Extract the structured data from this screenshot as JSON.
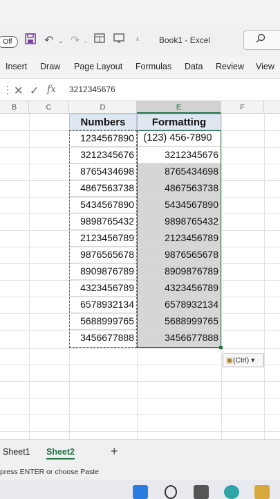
{
  "titlebar": {
    "autosave": "Off",
    "title": "Book1 - Excel"
  },
  "ribbon": {
    "tabs": [
      "Insert",
      "Draw",
      "Page Layout",
      "Formulas",
      "Data",
      "Review",
      "View"
    ]
  },
  "formula_bar": {
    "fx": "fx",
    "value": "3212345676"
  },
  "columns": [
    "B",
    "C",
    "D",
    "E",
    "F"
  ],
  "table": {
    "headers": [
      "Numbers",
      "Formatting"
    ],
    "rows": [
      [
        "1234567890",
        "(123) 456-7890"
      ],
      [
        "3212345676",
        "3212345676"
      ],
      [
        "8765434698",
        "8765434698"
      ],
      [
        "4867563738",
        "4867563738"
      ],
      [
        "5434567890",
        "5434567890"
      ],
      [
        "9898765432",
        "9898765432"
      ],
      [
        "2123456789",
        "2123456789"
      ],
      [
        "9876565678",
        "9876565678"
      ],
      [
        "8909876789",
        "8909876789"
      ],
      [
        "4323456789",
        "4323456789"
      ],
      [
        "6578932134",
        "6578932134"
      ],
      [
        "5688999765",
        "5688999765"
      ],
      [
        "3456677888",
        "3456677888"
      ]
    ]
  },
  "paste_options": {
    "label": "(Ctrl)",
    "icon": "clipboard-icon"
  },
  "sheets": {
    "tabs": [
      "Sheet1",
      "Sheet2"
    ],
    "active": "Sheet2",
    "add": "+"
  },
  "status": {
    "text": "press ENTER or choose Paste"
  },
  "colors": {
    "accent": "#217346",
    "header_fill": "#dfe7f1",
    "selection": "#d6d6d6"
  }
}
